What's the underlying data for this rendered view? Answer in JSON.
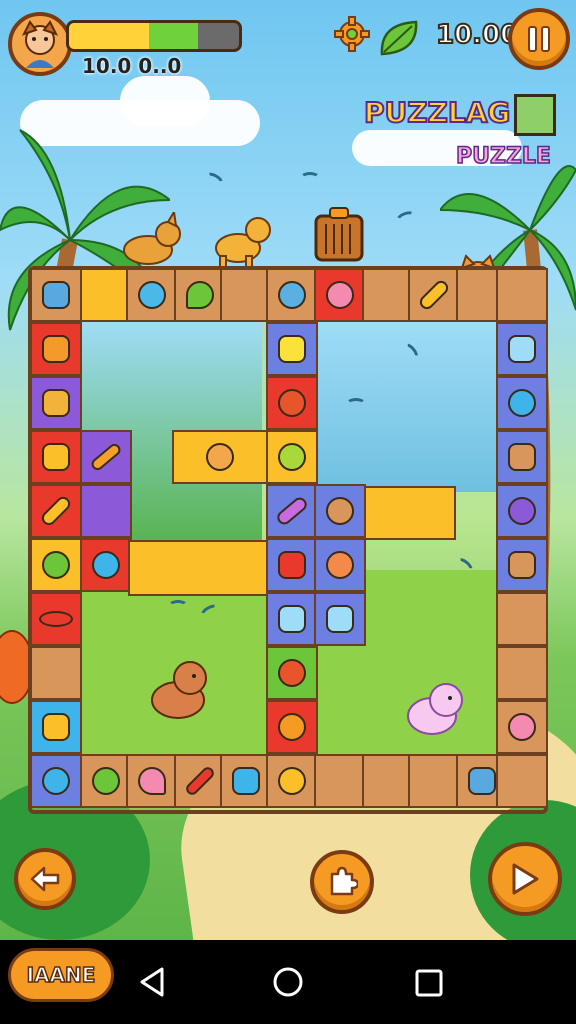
{
  "hud": {
    "score_text": "10.0 0..0",
    "progress_fraction": 0.76,
    "coins_text": "10.00",
    "icons": [
      "avatar-icon",
      "gear-icon",
      "leaf-icon",
      "pause-icon"
    ]
  },
  "logo": {
    "line1": "PUZZLAG",
    "line2": "PUZZLE"
  },
  "controls": {
    "back_icon": "back-arrow-icon",
    "center_icon": "puzzle-piece-icon",
    "play_icon": "play-icon"
  },
  "nav": {
    "name_button_label": "IAANE",
    "icons": [
      "back-triangle-icon",
      "home-circle-icon",
      "recents-square-icon"
    ]
  },
  "colors": {
    "accent_orange": "#f59a23",
    "border_brown": "#7a3b12",
    "tile_red": "#e8392c",
    "tile_yellow": "#fbbf2a",
    "tile_blue": "#6d7fe0"
  }
}
